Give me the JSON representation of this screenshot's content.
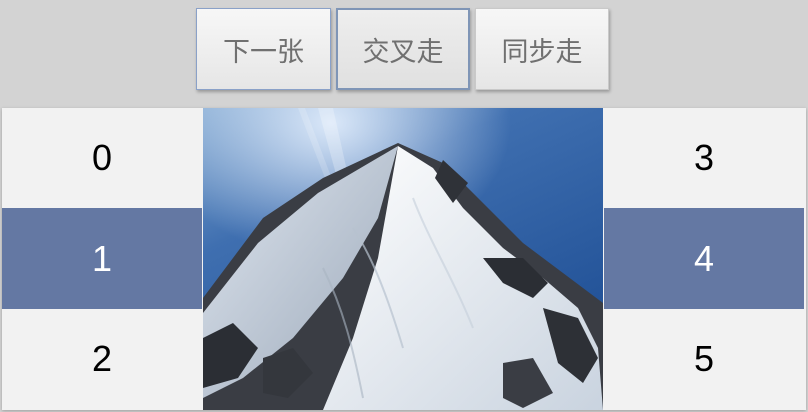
{
  "toolbar": {
    "buttons": [
      {
        "label": "下一张"
      },
      {
        "label": "交叉走"
      },
      {
        "label": "同步走"
      }
    ]
  },
  "left_list": {
    "items": [
      "0",
      "1",
      "2"
    ],
    "selected_index": 1
  },
  "right_list": {
    "items": [
      "3",
      "4",
      "5"
    ],
    "selected_index": 1
  },
  "image": {
    "subject": "snow-covered-mountain-peak"
  },
  "colors": {
    "selected_row": "#6478a3",
    "focus_border": "#7f95b6",
    "panel_bg": "#f2f2f2",
    "page_bg": "#d3d3d3"
  }
}
